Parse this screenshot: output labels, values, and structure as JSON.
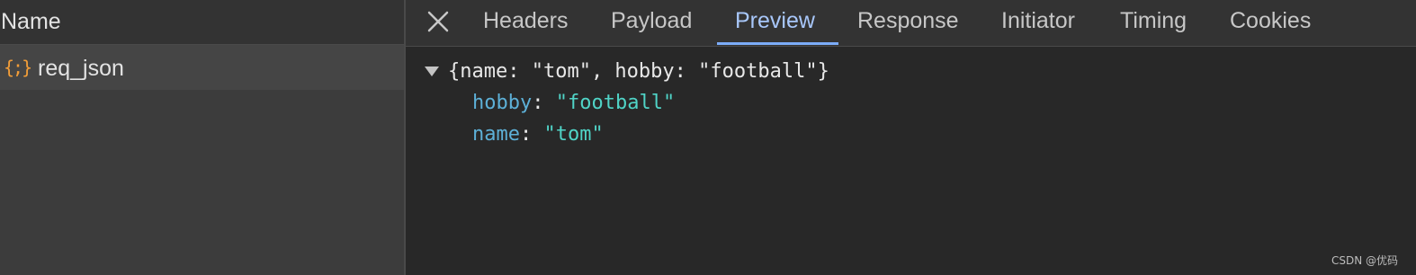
{
  "request_list": {
    "header_label": "Name",
    "items": [
      {
        "icon": "json-braces-icon",
        "icon_glyph": "{;}",
        "name": "req_json"
      }
    ]
  },
  "tabs": [
    {
      "label": "Headers"
    },
    {
      "label": "Payload"
    },
    {
      "label": "Preview"
    },
    {
      "label": "Response"
    },
    {
      "label": "Initiator"
    },
    {
      "label": "Timing"
    },
    {
      "label": "Cookies"
    }
  ],
  "active_tab": "Preview",
  "preview": {
    "summary": "{name: \"tom\", hobby: \"football\"}",
    "properties": [
      {
        "key": "hobby",
        "value": "\"football\""
      },
      {
        "key": "name",
        "value": "\"tom\""
      }
    ]
  },
  "watermark": "CSDN @优码",
  "colors": {
    "active_tab": "#a8c7fa",
    "tab_underline": "#7cacf8",
    "json_icon": "#f29d38",
    "json_key": "#5db0d7",
    "json_string": "#4ec9b0"
  }
}
